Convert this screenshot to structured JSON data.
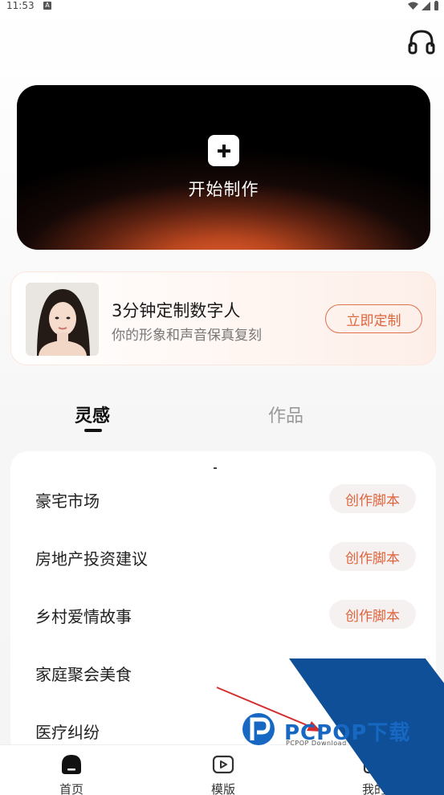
{
  "status_bar": {
    "time": "11:53",
    "notification_badge": "A"
  },
  "header": {
    "icon": "headphone-icon"
  },
  "hero": {
    "title": "开始制作",
    "icon": "plus-icon"
  },
  "promo": {
    "title": "3分钟定制数字人",
    "subtitle": "你的形象和声音保真复刻",
    "button": "立即定制"
  },
  "tabs": [
    {
      "label": "灵感",
      "active": true
    },
    {
      "label": "作品",
      "active": false
    }
  ],
  "list": [
    {
      "label": "豪宅市场",
      "button": "创作脚本"
    },
    {
      "label": "房地产投资建议",
      "button": "创作脚本"
    },
    {
      "label": "乡村爱情故事",
      "button": "创作脚本"
    },
    {
      "label": "家庭聚会美食",
      "button": ""
    },
    {
      "label": "医疗纠纷",
      "button": ""
    }
  ],
  "bottom_nav": [
    {
      "label": "首页",
      "icon": "home-icon",
      "active": true
    },
    {
      "label": "模版",
      "icon": "video-template-icon",
      "active": false
    },
    {
      "label": "我的",
      "icon": "profile-icon",
      "active": false
    }
  ],
  "watermark": {
    "main": "PCPOP下载",
    "sub": "PCPOP Download"
  },
  "colors": {
    "accent": "#e0643c",
    "dark": "#000000",
    "watermark_blue": "#0e4f98"
  }
}
